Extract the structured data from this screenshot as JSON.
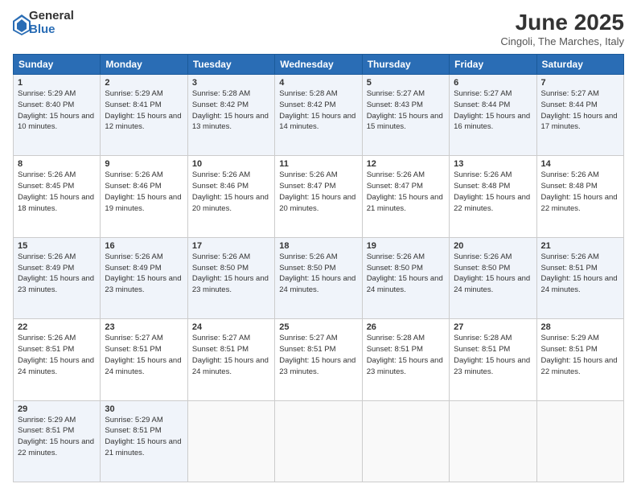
{
  "header": {
    "logo": {
      "general": "General",
      "blue": "Blue"
    },
    "title": "June 2025",
    "subtitle": "Cingoli, The Marches, Italy"
  },
  "calendar": {
    "headers": [
      "Sunday",
      "Monday",
      "Tuesday",
      "Wednesday",
      "Thursday",
      "Friday",
      "Saturday"
    ],
    "weeks": [
      [
        null,
        {
          "day": "2",
          "sunrise": "5:29 AM",
          "sunset": "8:41 PM",
          "daylight": "15 hours and 12 minutes."
        },
        {
          "day": "3",
          "sunrise": "5:28 AM",
          "sunset": "8:42 PM",
          "daylight": "15 hours and 13 minutes."
        },
        {
          "day": "4",
          "sunrise": "5:28 AM",
          "sunset": "8:42 PM",
          "daylight": "15 hours and 14 minutes."
        },
        {
          "day": "5",
          "sunrise": "5:27 AM",
          "sunset": "8:43 PM",
          "daylight": "15 hours and 15 minutes."
        },
        {
          "day": "6",
          "sunrise": "5:27 AM",
          "sunset": "8:44 PM",
          "daylight": "15 hours and 16 minutes."
        },
        {
          "day": "7",
          "sunrise": "5:27 AM",
          "sunset": "8:44 PM",
          "daylight": "15 hours and 17 minutes."
        }
      ],
      [
        {
          "day": "1",
          "sunrise": "5:29 AM",
          "sunset": "8:40 PM",
          "daylight": "15 hours and 10 minutes."
        },
        {
          "day": "9",
          "sunrise": "5:26 AM",
          "sunset": "8:46 PM",
          "daylight": "15 hours and 19 minutes."
        },
        {
          "day": "10",
          "sunrise": "5:26 AM",
          "sunset": "8:46 PM",
          "daylight": "15 hours and 20 minutes."
        },
        {
          "day": "11",
          "sunrise": "5:26 AM",
          "sunset": "8:47 PM",
          "daylight": "15 hours and 20 minutes."
        },
        {
          "day": "12",
          "sunrise": "5:26 AM",
          "sunset": "8:47 PM",
          "daylight": "15 hours and 21 minutes."
        },
        {
          "day": "13",
          "sunrise": "5:26 AM",
          "sunset": "8:48 PM",
          "daylight": "15 hours and 22 minutes."
        },
        {
          "day": "14",
          "sunrise": "5:26 AM",
          "sunset": "8:48 PM",
          "daylight": "15 hours and 22 minutes."
        }
      ],
      [
        {
          "day": "8",
          "sunrise": "5:26 AM",
          "sunset": "8:45 PM",
          "daylight": "15 hours and 18 minutes."
        },
        {
          "day": "16",
          "sunrise": "5:26 AM",
          "sunset": "8:49 PM",
          "daylight": "15 hours and 23 minutes."
        },
        {
          "day": "17",
          "sunrise": "5:26 AM",
          "sunset": "8:50 PM",
          "daylight": "15 hours and 23 minutes."
        },
        {
          "day": "18",
          "sunrise": "5:26 AM",
          "sunset": "8:50 PM",
          "daylight": "15 hours and 24 minutes."
        },
        {
          "day": "19",
          "sunrise": "5:26 AM",
          "sunset": "8:50 PM",
          "daylight": "15 hours and 24 minutes."
        },
        {
          "day": "20",
          "sunrise": "5:26 AM",
          "sunset": "8:50 PM",
          "daylight": "15 hours and 24 minutes."
        },
        {
          "day": "21",
          "sunrise": "5:26 AM",
          "sunset": "8:51 PM",
          "daylight": "15 hours and 24 minutes."
        }
      ],
      [
        {
          "day": "15",
          "sunrise": "5:26 AM",
          "sunset": "8:49 PM",
          "daylight": "15 hours and 23 minutes."
        },
        {
          "day": "23",
          "sunrise": "5:27 AM",
          "sunset": "8:51 PM",
          "daylight": "15 hours and 24 minutes."
        },
        {
          "day": "24",
          "sunrise": "5:27 AM",
          "sunset": "8:51 PM",
          "daylight": "15 hours and 24 minutes."
        },
        {
          "day": "25",
          "sunrise": "5:27 AM",
          "sunset": "8:51 PM",
          "daylight": "15 hours and 23 minutes."
        },
        {
          "day": "26",
          "sunrise": "5:28 AM",
          "sunset": "8:51 PM",
          "daylight": "15 hours and 23 minutes."
        },
        {
          "day": "27",
          "sunrise": "5:28 AM",
          "sunset": "8:51 PM",
          "daylight": "15 hours and 23 minutes."
        },
        {
          "day": "28",
          "sunrise": "5:29 AM",
          "sunset": "8:51 PM",
          "daylight": "15 hours and 22 minutes."
        }
      ],
      [
        {
          "day": "22",
          "sunrise": "5:26 AM",
          "sunset": "8:51 PM",
          "daylight": "15 hours and 24 minutes."
        },
        {
          "day": "30",
          "sunrise": "5:29 AM",
          "sunset": "8:51 PM",
          "daylight": "15 hours and 21 minutes."
        },
        null,
        null,
        null,
        null,
        null
      ],
      [
        {
          "day": "29",
          "sunrise": "5:29 AM",
          "sunset": "8:51 PM",
          "daylight": "15 hours and 22 minutes."
        },
        null,
        null,
        null,
        null,
        null,
        null
      ]
    ]
  }
}
